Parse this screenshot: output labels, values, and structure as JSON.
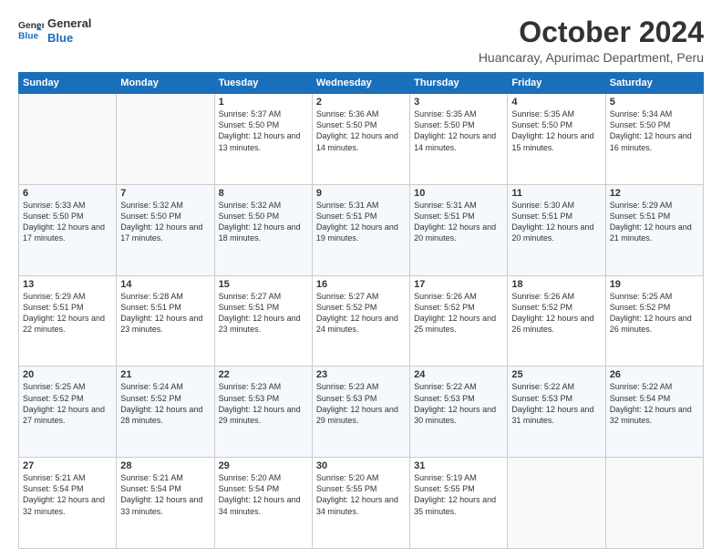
{
  "logo": {
    "line1": "General",
    "line2": "Blue"
  },
  "title": "October 2024",
  "subtitle": "Huancaray, Apurimac Department, Peru",
  "days_of_week": [
    "Sunday",
    "Monday",
    "Tuesday",
    "Wednesday",
    "Thursday",
    "Friday",
    "Saturday"
  ],
  "weeks": [
    [
      {
        "day": "",
        "sunrise": "",
        "sunset": "",
        "daylight": ""
      },
      {
        "day": "",
        "sunrise": "",
        "sunset": "",
        "daylight": ""
      },
      {
        "day": "1",
        "sunrise": "Sunrise: 5:37 AM",
        "sunset": "Sunset: 5:50 PM",
        "daylight": "Daylight: 12 hours and 13 minutes."
      },
      {
        "day": "2",
        "sunrise": "Sunrise: 5:36 AM",
        "sunset": "Sunset: 5:50 PM",
        "daylight": "Daylight: 12 hours and 14 minutes."
      },
      {
        "day": "3",
        "sunrise": "Sunrise: 5:35 AM",
        "sunset": "Sunset: 5:50 PM",
        "daylight": "Daylight: 12 hours and 14 minutes."
      },
      {
        "day": "4",
        "sunrise": "Sunrise: 5:35 AM",
        "sunset": "Sunset: 5:50 PM",
        "daylight": "Daylight: 12 hours and 15 minutes."
      },
      {
        "day": "5",
        "sunrise": "Sunrise: 5:34 AM",
        "sunset": "Sunset: 5:50 PM",
        "daylight": "Daylight: 12 hours and 16 minutes."
      }
    ],
    [
      {
        "day": "6",
        "sunrise": "Sunrise: 5:33 AM",
        "sunset": "Sunset: 5:50 PM",
        "daylight": "Daylight: 12 hours and 17 minutes."
      },
      {
        "day": "7",
        "sunrise": "Sunrise: 5:32 AM",
        "sunset": "Sunset: 5:50 PM",
        "daylight": "Daylight: 12 hours and 17 minutes."
      },
      {
        "day": "8",
        "sunrise": "Sunrise: 5:32 AM",
        "sunset": "Sunset: 5:50 PM",
        "daylight": "Daylight: 12 hours and 18 minutes."
      },
      {
        "day": "9",
        "sunrise": "Sunrise: 5:31 AM",
        "sunset": "Sunset: 5:51 PM",
        "daylight": "Daylight: 12 hours and 19 minutes."
      },
      {
        "day": "10",
        "sunrise": "Sunrise: 5:31 AM",
        "sunset": "Sunset: 5:51 PM",
        "daylight": "Daylight: 12 hours and 20 minutes."
      },
      {
        "day": "11",
        "sunrise": "Sunrise: 5:30 AM",
        "sunset": "Sunset: 5:51 PM",
        "daylight": "Daylight: 12 hours and 20 minutes."
      },
      {
        "day": "12",
        "sunrise": "Sunrise: 5:29 AM",
        "sunset": "Sunset: 5:51 PM",
        "daylight": "Daylight: 12 hours and 21 minutes."
      }
    ],
    [
      {
        "day": "13",
        "sunrise": "Sunrise: 5:29 AM",
        "sunset": "Sunset: 5:51 PM",
        "daylight": "Daylight: 12 hours and 22 minutes."
      },
      {
        "day": "14",
        "sunrise": "Sunrise: 5:28 AM",
        "sunset": "Sunset: 5:51 PM",
        "daylight": "Daylight: 12 hours and 23 minutes."
      },
      {
        "day": "15",
        "sunrise": "Sunrise: 5:27 AM",
        "sunset": "Sunset: 5:51 PM",
        "daylight": "Daylight: 12 hours and 23 minutes."
      },
      {
        "day": "16",
        "sunrise": "Sunrise: 5:27 AM",
        "sunset": "Sunset: 5:52 PM",
        "daylight": "Daylight: 12 hours and 24 minutes."
      },
      {
        "day": "17",
        "sunrise": "Sunrise: 5:26 AM",
        "sunset": "Sunset: 5:52 PM",
        "daylight": "Daylight: 12 hours and 25 minutes."
      },
      {
        "day": "18",
        "sunrise": "Sunrise: 5:26 AM",
        "sunset": "Sunset: 5:52 PM",
        "daylight": "Daylight: 12 hours and 26 minutes."
      },
      {
        "day": "19",
        "sunrise": "Sunrise: 5:25 AM",
        "sunset": "Sunset: 5:52 PM",
        "daylight": "Daylight: 12 hours and 26 minutes."
      }
    ],
    [
      {
        "day": "20",
        "sunrise": "Sunrise: 5:25 AM",
        "sunset": "Sunset: 5:52 PM",
        "daylight": "Daylight: 12 hours and 27 minutes."
      },
      {
        "day": "21",
        "sunrise": "Sunrise: 5:24 AM",
        "sunset": "Sunset: 5:52 PM",
        "daylight": "Daylight: 12 hours and 28 minutes."
      },
      {
        "day": "22",
        "sunrise": "Sunrise: 5:23 AM",
        "sunset": "Sunset: 5:53 PM",
        "daylight": "Daylight: 12 hours and 29 minutes."
      },
      {
        "day": "23",
        "sunrise": "Sunrise: 5:23 AM",
        "sunset": "Sunset: 5:53 PM",
        "daylight": "Daylight: 12 hours and 29 minutes."
      },
      {
        "day": "24",
        "sunrise": "Sunrise: 5:22 AM",
        "sunset": "Sunset: 5:53 PM",
        "daylight": "Daylight: 12 hours and 30 minutes."
      },
      {
        "day": "25",
        "sunrise": "Sunrise: 5:22 AM",
        "sunset": "Sunset: 5:53 PM",
        "daylight": "Daylight: 12 hours and 31 minutes."
      },
      {
        "day": "26",
        "sunrise": "Sunrise: 5:22 AM",
        "sunset": "Sunset: 5:54 PM",
        "daylight": "Daylight: 12 hours and 32 minutes."
      }
    ],
    [
      {
        "day": "27",
        "sunrise": "Sunrise: 5:21 AM",
        "sunset": "Sunset: 5:54 PM",
        "daylight": "Daylight: 12 hours and 32 minutes."
      },
      {
        "day": "28",
        "sunrise": "Sunrise: 5:21 AM",
        "sunset": "Sunset: 5:54 PM",
        "daylight": "Daylight: 12 hours and 33 minutes."
      },
      {
        "day": "29",
        "sunrise": "Sunrise: 5:20 AM",
        "sunset": "Sunset: 5:54 PM",
        "daylight": "Daylight: 12 hours and 34 minutes."
      },
      {
        "day": "30",
        "sunrise": "Sunrise: 5:20 AM",
        "sunset": "Sunset: 5:55 PM",
        "daylight": "Daylight: 12 hours and 34 minutes."
      },
      {
        "day": "31",
        "sunrise": "Sunrise: 5:19 AM",
        "sunset": "Sunset: 5:55 PM",
        "daylight": "Daylight: 12 hours and 35 minutes."
      },
      {
        "day": "",
        "sunrise": "",
        "sunset": "",
        "daylight": ""
      },
      {
        "day": "",
        "sunrise": "",
        "sunset": "",
        "daylight": ""
      }
    ]
  ]
}
